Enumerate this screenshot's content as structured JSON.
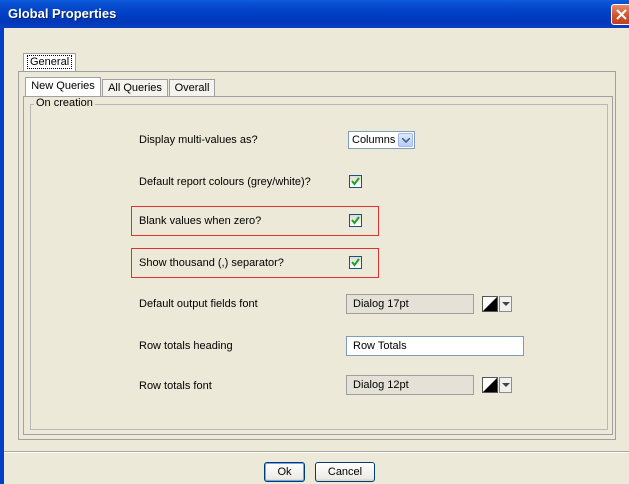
{
  "window": {
    "title": "Global Properties"
  },
  "outer_tabs": [
    {
      "label": "General",
      "selected": true
    }
  ],
  "inner_tabs": [
    {
      "label": "New Queries",
      "selected": true
    },
    {
      "label": "All Queries",
      "selected": false
    },
    {
      "label": "Overall",
      "selected": false
    }
  ],
  "group": {
    "title": "On creation"
  },
  "settings": {
    "display_multi": {
      "label": "Display multi-values as?",
      "value": "Columns",
      "icon": "chevron-down-icon"
    },
    "report_colours": {
      "label": "Default report colours (grey/white)?",
      "checked": true
    },
    "blank_zero": {
      "label": "Blank values when zero?",
      "checked": true,
      "highlighted": true
    },
    "thousand_sep": {
      "label": "Show thousand (,) separator?",
      "checked": true,
      "highlighted": true
    },
    "output_font": {
      "label": "Default output fields font",
      "value": "Dialog 17pt"
    },
    "row_totals_heading": {
      "label": "Row totals heading",
      "value": "Row Totals"
    },
    "row_totals_font": {
      "label": "Row totals font",
      "value": "Dialog 12pt"
    }
  },
  "buttons": {
    "ok": "Ok",
    "cancel": "Cancel"
  },
  "colors": {
    "titlebar": "#0041c8",
    "highlight_border": "#e03030",
    "dialog_bg": "#ece9d8",
    "check": "#21a121"
  }
}
